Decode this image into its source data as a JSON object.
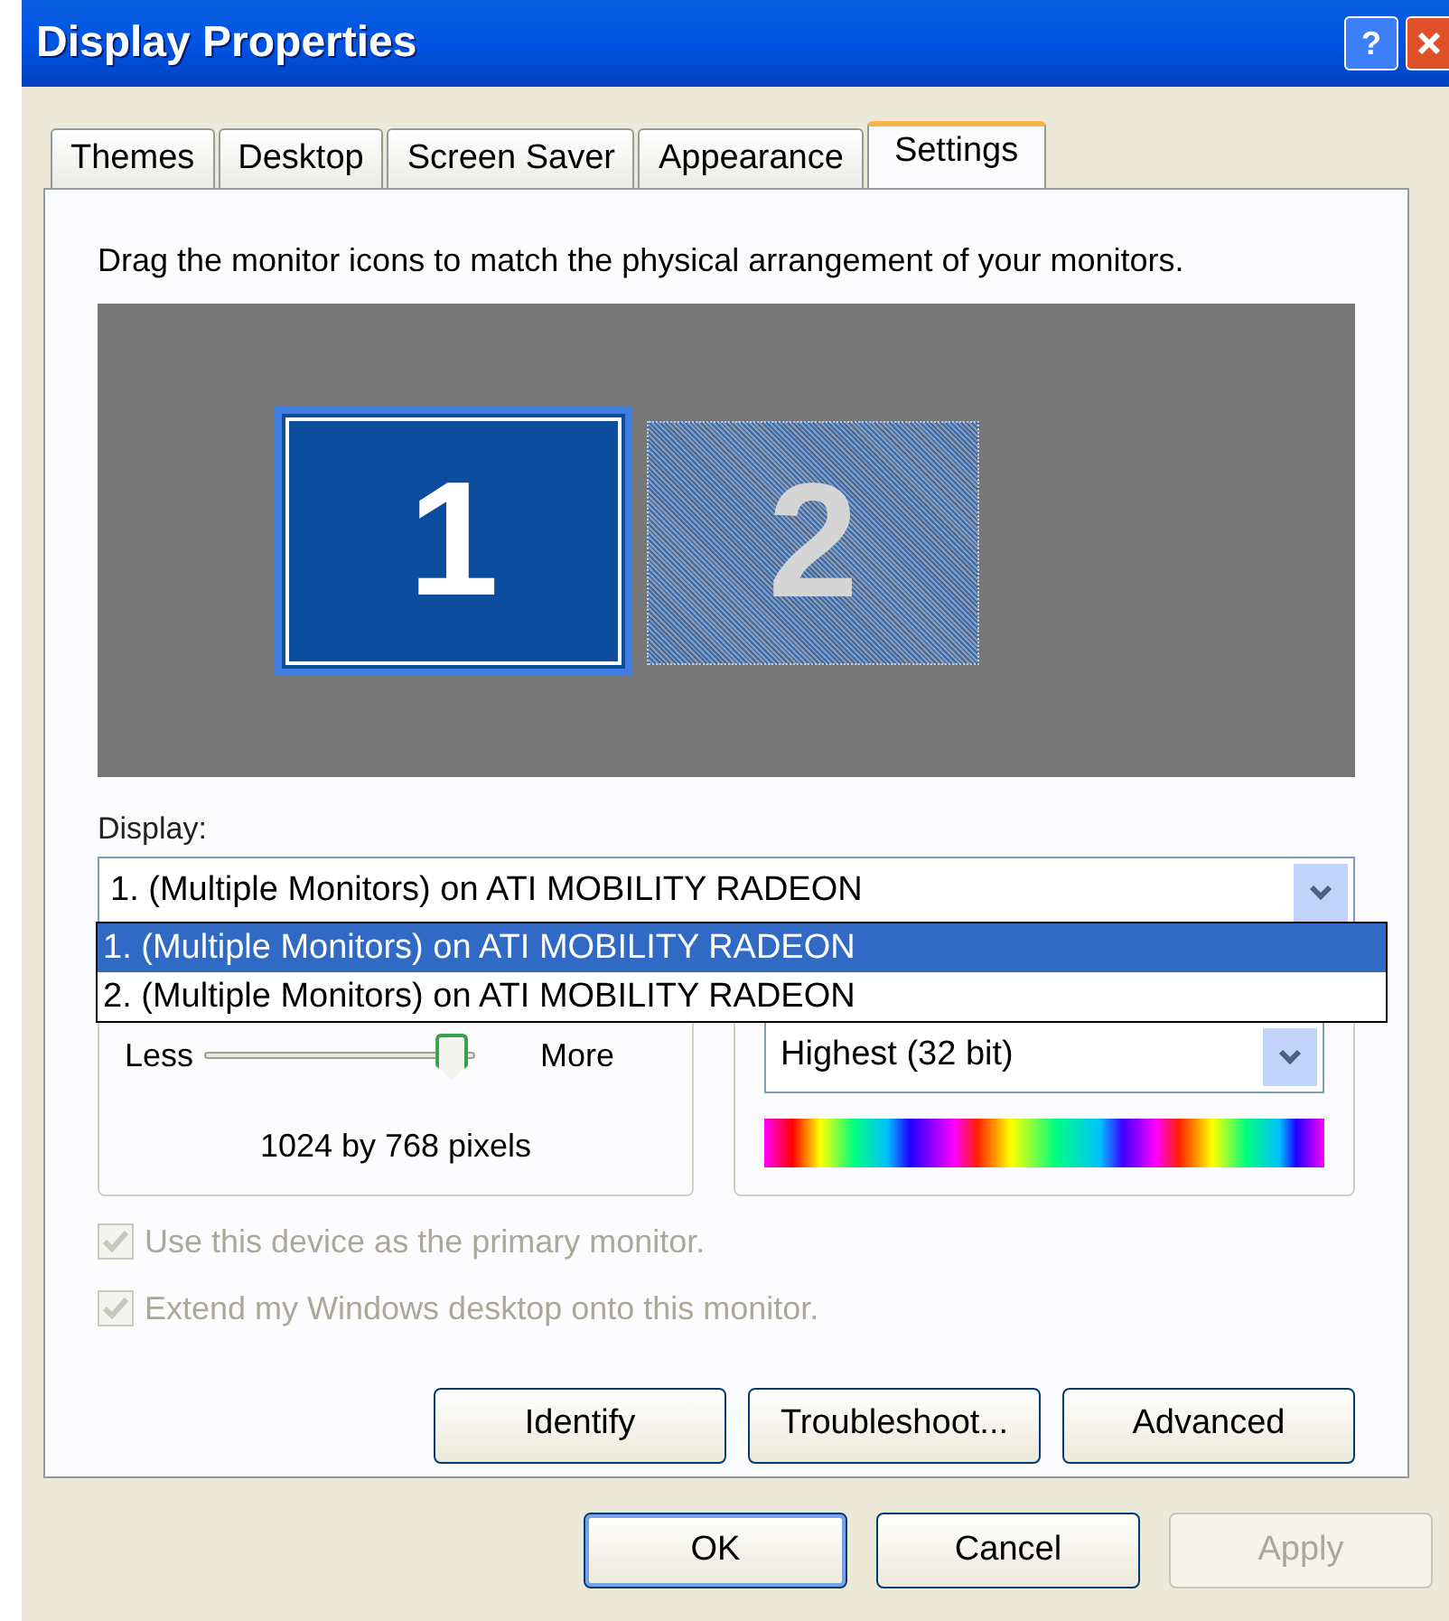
{
  "window": {
    "title": "Display Properties",
    "help": "?"
  },
  "tabs": [
    {
      "label": "Themes",
      "selected": false
    },
    {
      "label": "Desktop",
      "selected": false
    },
    {
      "label": "Screen Saver",
      "selected": false
    },
    {
      "label": "Appearance",
      "selected": false
    },
    {
      "label": "Settings",
      "selected": true
    }
  ],
  "instructions": "Drag the monitor icons to match the physical arrangement of your monitors.",
  "monitors": [
    {
      "label": "1",
      "selected": true
    },
    {
      "label": "2",
      "selected": false
    }
  ],
  "display": {
    "label": "Display:",
    "value": "1. (Multiple Monitors) on ATI MOBILITY RADEON",
    "expanded": true,
    "options": [
      {
        "label": "1. (Multiple Monitors) on ATI MOBILITY RADEON",
        "selected": true
      },
      {
        "label": "2. (Multiple Monitors) on ATI MOBILITY RADEON",
        "selected": false
      }
    ]
  },
  "resolution": {
    "less": "Less",
    "more": "More",
    "level": 0.97,
    "reading": "1024 by 768 pixels"
  },
  "color_quality": {
    "value": "Highest (32 bit)"
  },
  "checkboxes": [
    {
      "label": "Use this device as the primary monitor.",
      "checked": true,
      "disabled": true
    },
    {
      "label": "Extend my Windows desktop onto this monitor.",
      "checked": true,
      "disabled": true
    }
  ],
  "panel_buttons": [
    "Identify",
    "Troubleshoot...",
    "Advanced"
  ],
  "dialog_buttons": [
    {
      "label": "OK",
      "disabled": false,
      "default": true
    },
    {
      "label": "Cancel",
      "disabled": false,
      "default": false
    },
    {
      "label": "Apply",
      "disabled": true,
      "default": false
    }
  ]
}
